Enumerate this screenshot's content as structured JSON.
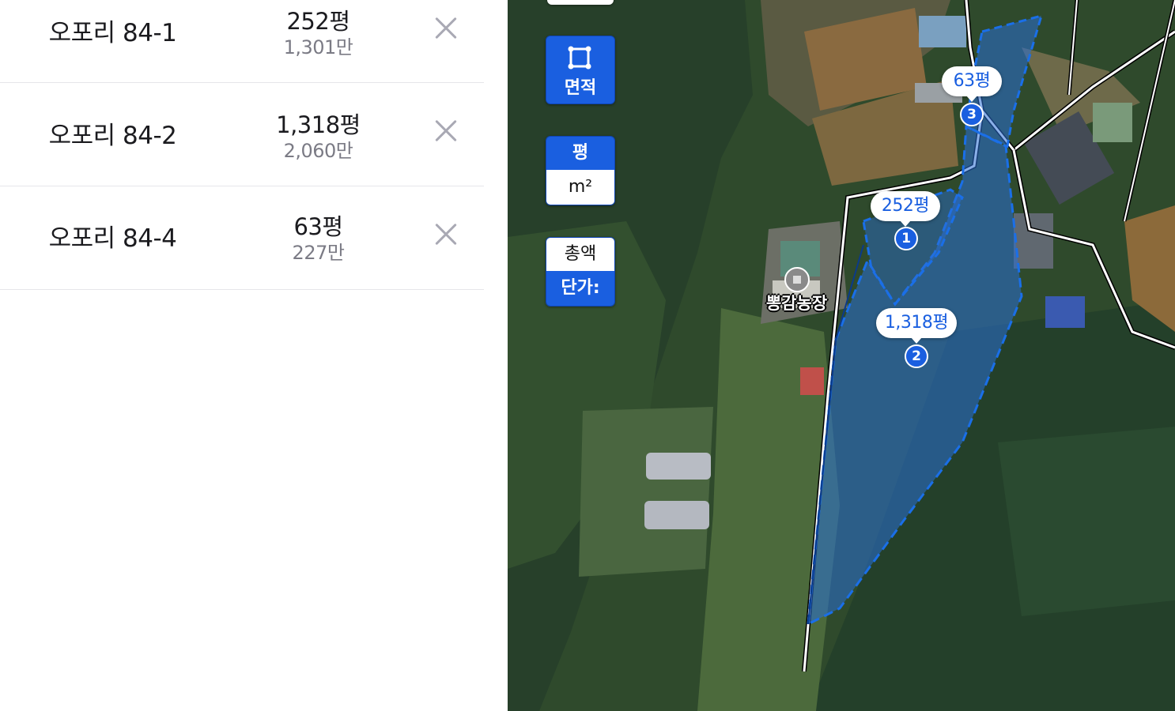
{
  "parcels": [
    {
      "name": "오포리 84-1",
      "area": "252평",
      "price": "1,301만"
    },
    {
      "name": "오포리 84-2",
      "area": "1,318평",
      "price": "2,060만"
    },
    {
      "name": "오포리 84-4",
      "area": "63평",
      "price": "227만"
    }
  ],
  "map_controls": {
    "area_button": "면적",
    "unit_pyeong": "평",
    "unit_m2": "m²",
    "total_price": "총액",
    "unit_price": "단가:"
  },
  "map_markers": [
    {
      "area": "252평",
      "number": "1"
    },
    {
      "area": "1,318평",
      "number": "2"
    },
    {
      "area": "63평",
      "number": "3"
    }
  ],
  "poi": {
    "label": "뽕감농장"
  },
  "colors": {
    "accent": "#1a5fe0",
    "parcel_fill": "#2a6fd6",
    "close_icon": "#a9a9b4"
  }
}
